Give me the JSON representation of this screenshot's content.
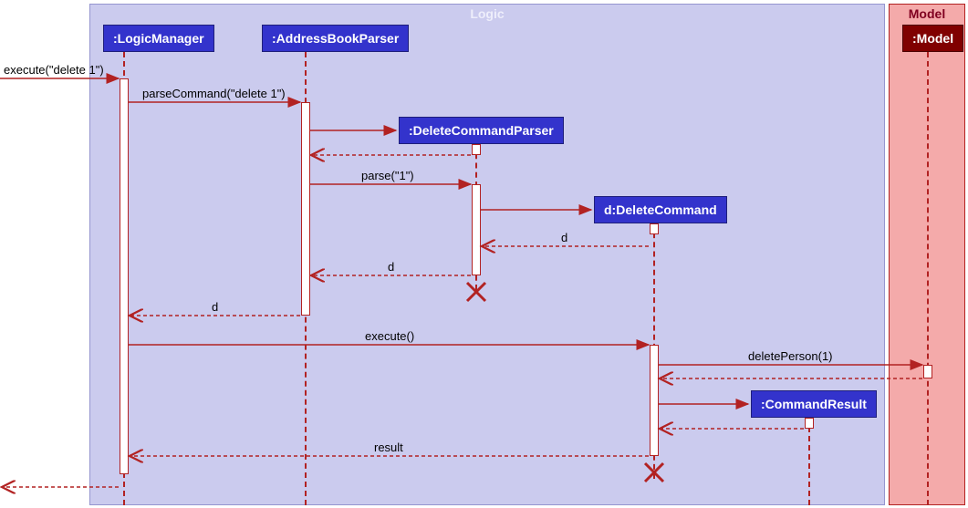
{
  "frames": {
    "logic": {
      "label": "Logic",
      "color_bg": "#CBCBEE",
      "color_border": "#9595CF",
      "color_text": "#EEEEFB"
    },
    "model": {
      "label": "Model",
      "color_bg": "#F4AAAA",
      "color_border": "#B22222",
      "color_text": "#800020"
    }
  },
  "participants": {
    "logic_manager": {
      "label": ":LogicManager",
      "bg": "#3333CC",
      "border": "#1E1E7A"
    },
    "address_book_parser": {
      "label": ":AddressBookParser",
      "bg": "#3333CC",
      "border": "#1E1E7A"
    },
    "delete_command_parser": {
      "label": ":DeleteCommandParser",
      "bg": "#3333CC",
      "border": "#1E1E7A"
    },
    "delete_command": {
      "label": "d:DeleteCommand",
      "bg": "#3333CC",
      "border": "#1E1E7A"
    },
    "command_result": {
      "label": ":CommandResult",
      "bg": "#3333CC",
      "border": "#1E1E7A"
    },
    "model": {
      "label": ":Model",
      "bg": "#800000",
      "border": "#4C0000"
    }
  },
  "messages": {
    "m1": "execute(\"delete 1\")",
    "m2": "parseCommand(\"delete 1\")",
    "m3": "parse(\"1\")",
    "m4_return": "d",
    "m5_return": "d",
    "m6_return": "d",
    "m7": "execute()",
    "m8": "deletePerson(1)",
    "m9_return": "result"
  },
  "chart_data": {
    "type": "sequence_diagram",
    "frames": [
      {
        "name": "Logic",
        "participants": [
          "LogicManager",
          "AddressBookParser",
          "DeleteCommandParser",
          "DeleteCommand",
          "CommandResult"
        ]
      },
      {
        "name": "Model",
        "participants": [
          "Model"
        ]
      }
    ],
    "participants": [
      {
        "id": "LogicManager",
        "label": ":LogicManager"
      },
      {
        "id": "AddressBookParser",
        "label": ":AddressBookParser"
      },
      {
        "id": "DeleteCommandParser",
        "label": ":DeleteCommandParser",
        "created_by_message": 3
      },
      {
        "id": "DeleteCommand",
        "label": "d:DeleteCommand",
        "created_by_message": 5
      },
      {
        "id": "CommandResult",
        "label": ":CommandResult",
        "created_by_message": 12
      },
      {
        "id": "Model",
        "label": ":Model"
      }
    ],
    "messages": [
      {
        "n": 1,
        "from": "external",
        "to": "LogicManager",
        "label": "execute(\"delete 1\")",
        "type": "sync"
      },
      {
        "n": 2,
        "from": "LogicManager",
        "to": "AddressBookParser",
        "label": "parseCommand(\"delete 1\")",
        "type": "sync"
      },
      {
        "n": 3,
        "from": "AddressBookParser",
        "to": "DeleteCommandParser",
        "label": "",
        "type": "create"
      },
      {
        "n": 4,
        "from": "DeleteCommandParser",
        "to": "AddressBookParser",
        "label": "",
        "type": "return"
      },
      {
        "n": 5,
        "from": "AddressBookParser",
        "to": "DeleteCommandParser",
        "label": "parse(\"1\")",
        "type": "sync"
      },
      {
        "n": 6,
        "from": "DeleteCommandParser",
        "to": "DeleteCommand",
        "label": "",
        "type": "create"
      },
      {
        "n": 7,
        "from": "DeleteCommand",
        "to": "DeleteCommandParser",
        "label": "d",
        "type": "return"
      },
      {
        "n": 8,
        "from": "DeleteCommandParser",
        "to": "AddressBookParser",
        "label": "d",
        "type": "return",
        "destroys": "DeleteCommandParser"
      },
      {
        "n": 9,
        "from": "AddressBookParser",
        "to": "LogicManager",
        "label": "d",
        "type": "return"
      },
      {
        "n": 10,
        "from": "LogicManager",
        "to": "DeleteCommand",
        "label": "execute()",
        "type": "sync"
      },
      {
        "n": 11,
        "from": "DeleteCommand",
        "to": "Model",
        "label": "deletePerson(1)",
        "type": "sync"
      },
      {
        "n": 12,
        "from": "Model",
        "to": "DeleteCommand",
        "label": "",
        "type": "return"
      },
      {
        "n": 13,
        "from": "DeleteCommand",
        "to": "CommandResult",
        "label": "",
        "type": "create"
      },
      {
        "n": 14,
        "from": "CommandResult",
        "to": "DeleteCommand",
        "label": "",
        "type": "return"
      },
      {
        "n": 15,
        "from": "DeleteCommand",
        "to": "LogicManager",
        "label": "result",
        "type": "return",
        "destroys": "DeleteCommand"
      },
      {
        "n": 16,
        "from": "LogicManager",
        "to": "external",
        "label": "",
        "type": "return"
      }
    ]
  }
}
